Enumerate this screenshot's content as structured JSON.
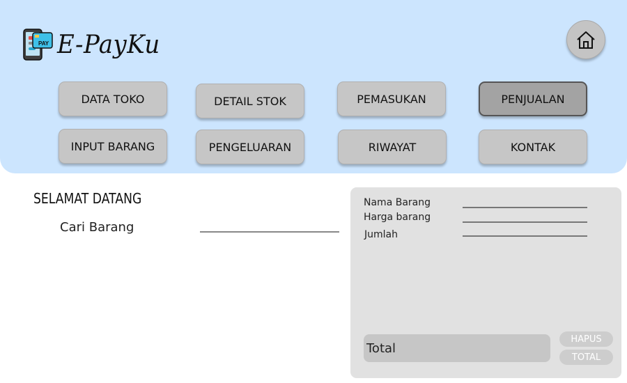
{
  "header": {
    "app_name": "E-PayKu",
    "logo_badge": "PAY",
    "home_icon": "home-icon",
    "background": "#cce5fe"
  },
  "nav": {
    "row1": [
      "DATA TOKO",
      "DETAIL STOK",
      "PEMASUKAN",
      "PENJUALAN"
    ],
    "row2": [
      "INPUT BARANG",
      "PENGELUARAN",
      "RIWAYAT",
      "KONTAK"
    ],
    "active": "PENJUALAN"
  },
  "main": {
    "welcome": "SELAMAT DATANG",
    "search_label": "Cari Barang",
    "search_value": ""
  },
  "form": {
    "fields": [
      {
        "label": "Nama Barang",
        "value": ""
      },
      {
        "label": "Harga barang",
        "value": ""
      },
      {
        "label": "Jumlah",
        "value": ""
      }
    ],
    "total_label": "Total",
    "hapus_label": "HAPUS",
    "total_button_label": "TOTAL"
  }
}
